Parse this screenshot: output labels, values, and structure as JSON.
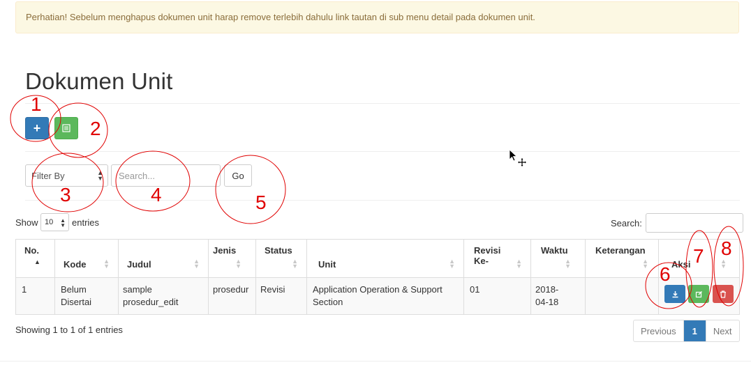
{
  "alert": {
    "text": "Perhatian! Sebelum menghapus dokumen unit harap remove terlebih dahulu link tautan di sub menu detail pada dokumen unit."
  },
  "page": {
    "title": "Dokumen Unit"
  },
  "toolbar": {
    "add_icon": "plus-icon",
    "list_icon": "list-icon"
  },
  "filter": {
    "filter_by_label": "Filter By",
    "search_placeholder": "Search...",
    "go_label": "Go"
  },
  "datatable": {
    "show_label": "Show",
    "page_length": "10",
    "entries_label": "entries",
    "search_label": "Search:",
    "columns": [
      "No.",
      "Kode",
      "Judul",
      "Jenis",
      "Status",
      "Unit",
      "Revisi Ke-",
      "Waktu",
      "Keterangan",
      "Aksi"
    ],
    "rows": [
      {
        "no": "1",
        "kode": "Belum Disertai",
        "judul": "sample prosedur_edit",
        "jenis": "prosedur",
        "status": "Revisi",
        "unit": "Application Operation & Support Section",
        "revisi": "01",
        "waktu": "2018-04-18",
        "keterangan": ""
      }
    ],
    "info": "Showing 1 to 1 of 1 entries",
    "pagination": {
      "previous": "Previous",
      "current": "1",
      "next": "Next"
    }
  },
  "annotations": [
    "1",
    "2",
    "3",
    "4",
    "5",
    "6",
    "7",
    "8"
  ],
  "colors": {
    "primary": "#337ab7",
    "success": "#5cb85c",
    "danger": "#d9534f",
    "warning_bg": "#fcf8e3",
    "warning_text": "#8a6d3b",
    "annotation_red": "#e00000"
  }
}
